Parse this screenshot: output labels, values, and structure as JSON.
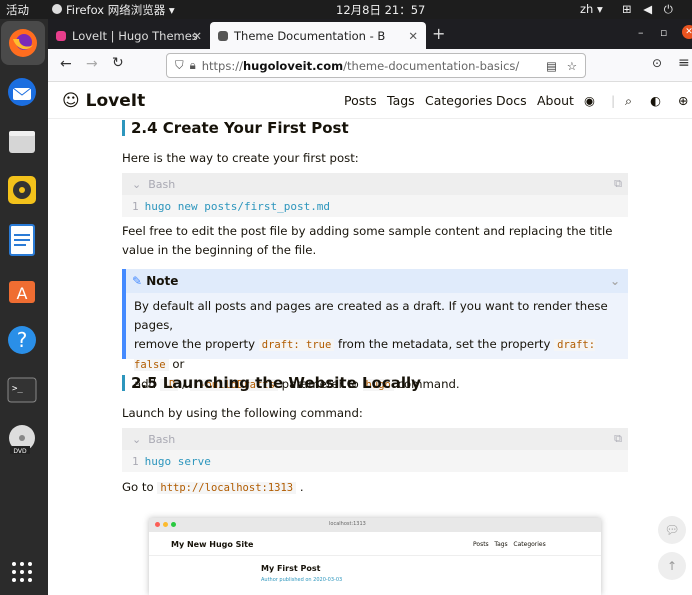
{
  "system": {
    "activities": "活动",
    "app_name": "Firefox 网络浏览器",
    "clock": "12月8日  21：57",
    "lang": "zh"
  },
  "tabs": [
    {
      "label": "LoveIt | Hugo Themes"
    },
    {
      "label": "Theme Documentation - B"
    }
  ],
  "address": {
    "url_prefix": "https://",
    "url_domain": "hugoloveit.com",
    "url_path": "/theme-documentation-basics/"
  },
  "site": {
    "logo": "LoveIt",
    "menu": [
      "Posts",
      "Tags",
      "Categories",
      "Docs",
      "About"
    ],
    "separator": "|"
  },
  "content": {
    "h_24": "2.4 Create Your First Post",
    "p_first": "Here is the way to create your first post:",
    "code1_lang": "Bash",
    "code1_line": "1",
    "code1_text": "hugo new posts/first_post.md",
    "p_feel": "Feel free to edit the post file by adding some sample content and replacing the title value in the beginning of the file.",
    "note_title": "Note",
    "note_t1": "By default all posts and pages are created as a draft. If you want to render these pages,",
    "note_t2": "remove the property",
    "note_c1": "draft: true",
    "note_t3": "from the metadata, set the property",
    "note_c2": "draft: false",
    "note_t4": "or",
    "note_t5": "add",
    "note_c3": "-D",
    "note_t6": "/",
    "note_c4": "--buildDrafts",
    "note_t7": "parameter to",
    "note_c5": "hugo",
    "note_t8": "command.",
    "h_25": "2.5 Launching the Website Locally",
    "p_launch": "Launch by using the following command:",
    "code2_lang": "Bash",
    "code2_line": "1",
    "code2_text": "hugo serve",
    "p_goto": "Go to",
    "goto_url": "http://localhost:1313",
    "goto_end": ".",
    "shot_site": "My New Hugo Site",
    "shot_url": "localhost:1313",
    "shot_menu": "Posts   Tags   Categories",
    "shot_post": "My First Post",
    "shot_meta": "Author published on 2020-03-03"
  }
}
